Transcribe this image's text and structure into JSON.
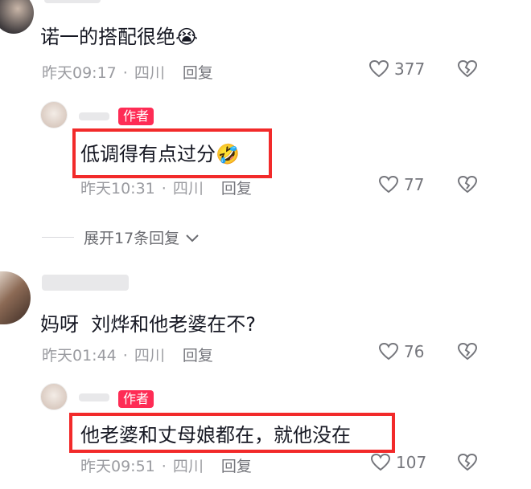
{
  "comments": [
    {
      "text": "诺一的搭配很绝",
      "emoji": "😭",
      "time": "昨天09:17",
      "location": "四川",
      "reply_label": "回复",
      "likes": "377",
      "reply": {
        "badge": "作者",
        "text": "低调得有点过分",
        "emoji": "🤣",
        "time": "昨天10:31",
        "location": "四川",
        "reply_label": "回复",
        "likes": "77"
      },
      "expand_label": "展开17条回复"
    },
    {
      "text": "妈呀  刘烨和他老婆在不?",
      "time": "昨天01:44",
      "location": "四川",
      "reply_label": "回复",
      "likes": "76",
      "reply": {
        "badge": "作者",
        "text": "他老婆和丈母娘都在，就他没在",
        "time": "昨天09:51",
        "location": "四川",
        "reply_label": "回复",
        "likes": "107"
      }
    }
  ],
  "colors": {
    "badge": "#fe2c55",
    "highlight_box": "#f22a2a"
  },
  "icons": [
    "heart-icon",
    "broken-heart-icon",
    "chevron-down-icon"
  ]
}
